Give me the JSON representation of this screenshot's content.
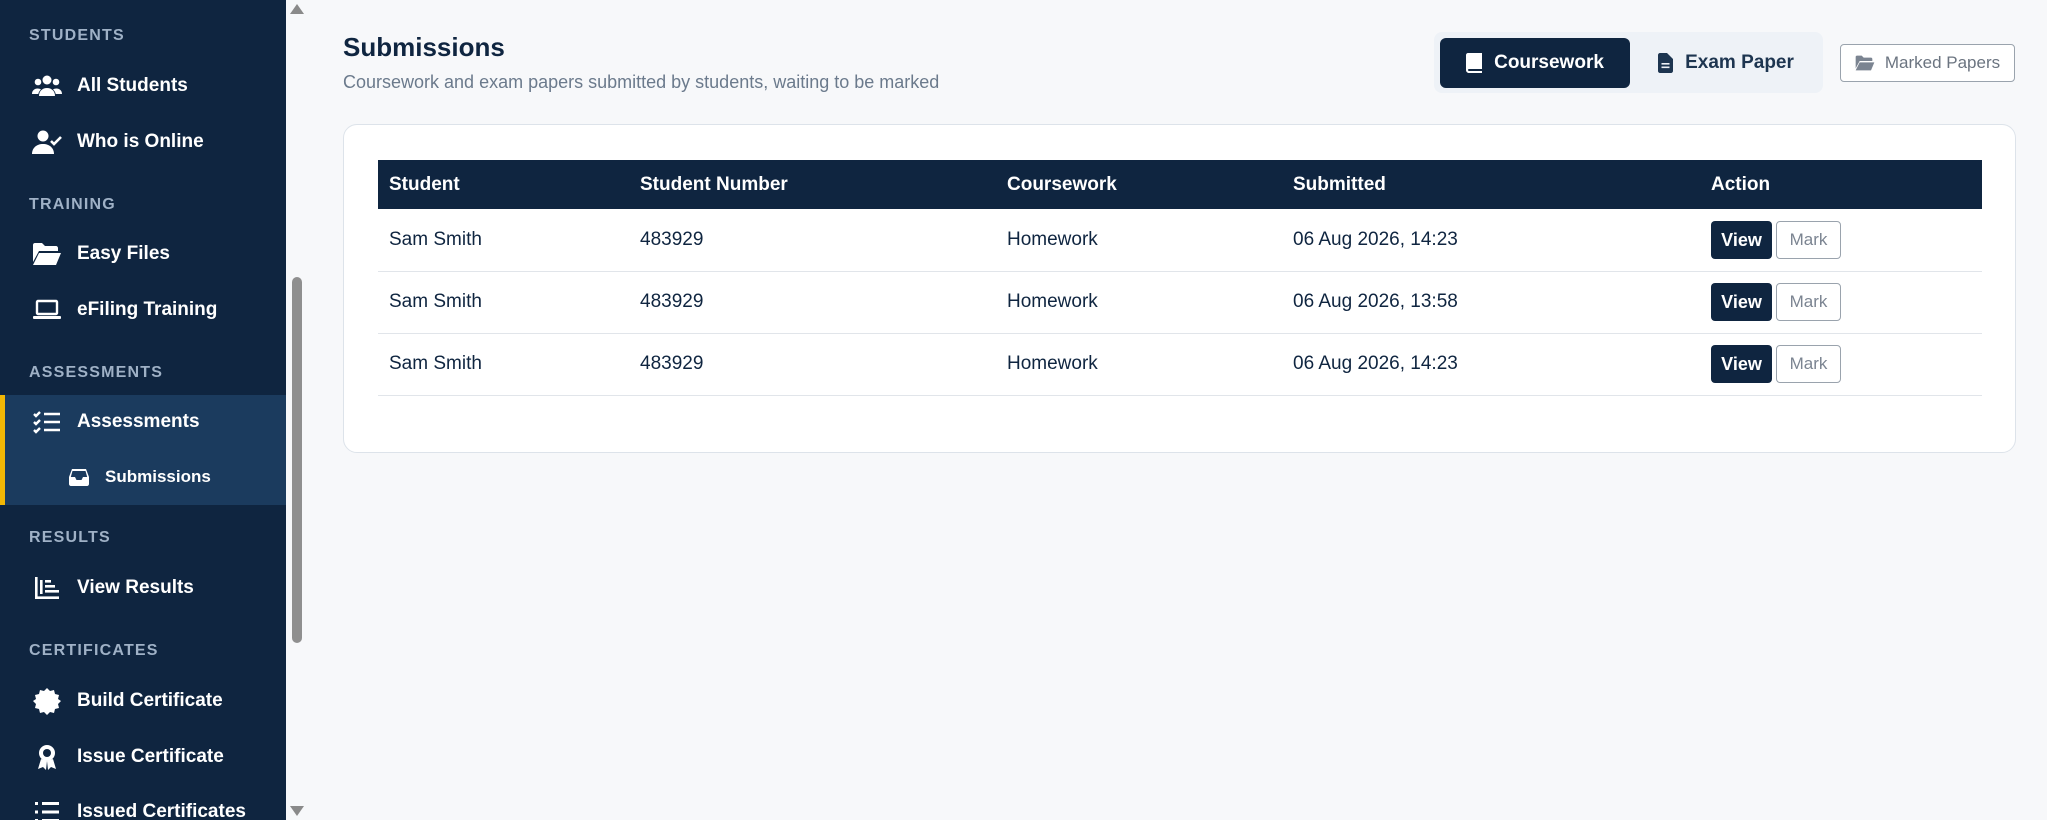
{
  "sidebar": {
    "sections": {
      "students": "STUDENTS",
      "training": "TRAINING",
      "assessments": "ASSESSMENTS",
      "results": "RESULTS",
      "certificates": "CERTIFICATES"
    },
    "items": {
      "all_students": {
        "label": "All Students",
        "icon": "users-icon"
      },
      "who_online": {
        "label": "Who is Online",
        "icon": "user-check-icon"
      },
      "easy_files": {
        "label": "Easy Files",
        "icon": "folder-open-icon"
      },
      "efiling": {
        "label": "eFiling Training",
        "icon": "laptop-icon"
      },
      "assessments": {
        "label": "Assessments",
        "icon": "list-check-icon"
      },
      "submissions": {
        "label": "Submissions",
        "icon": "inbox-icon"
      },
      "view_results": {
        "label": "View Results",
        "icon": "bar-chart-icon"
      },
      "build_certificate": {
        "label": "Build Certificate",
        "icon": "certificate-icon"
      },
      "issue_certificate": {
        "label": "Issue Certificate",
        "icon": "award-icon"
      },
      "issued_certificates": {
        "label": "Issued Certificates",
        "icon": "list-icon"
      }
    },
    "active_item": "Submissions",
    "accent_color": "#f2b705"
  },
  "header": {
    "title": "Submissions",
    "subtitle": "Coursework and exam papers submitted by students, waiting to be marked"
  },
  "tabs": {
    "coursework": "Coursework",
    "exam_paper": "Exam Paper",
    "active": "Coursework"
  },
  "marked_papers_label": "Marked Papers",
  "table": {
    "columns": [
      "Student",
      "Student Number",
      "Coursework",
      "Submitted",
      "Action"
    ],
    "rows": [
      {
        "student": "Sam Smith",
        "number": "483929",
        "coursework": "Homework",
        "submitted": "06 Aug 2026, 14:23"
      },
      {
        "student": "Sam Smith",
        "number": "483929",
        "coursework": "Homework",
        "submitted": "06 Aug 2026, 13:58"
      },
      {
        "student": "Sam Smith",
        "number": "483929",
        "coursework": "Homework",
        "submitted": "06 Aug 2026, 14:23"
      }
    ],
    "view_label": "View",
    "mark_label": "Mark"
  },
  "colors": {
    "navy": "#0f2540",
    "background": "#f7f8fa"
  }
}
